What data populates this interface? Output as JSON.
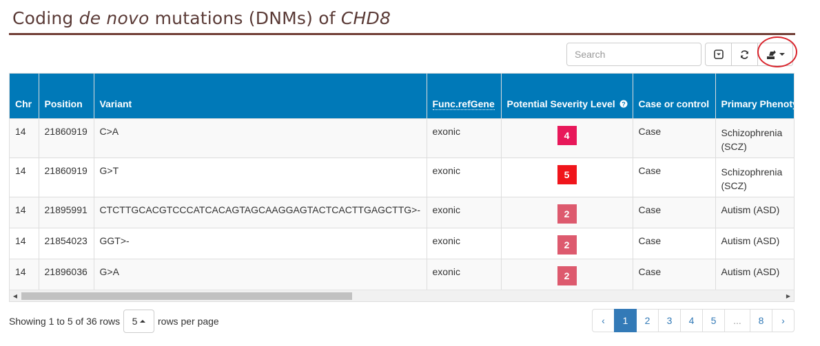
{
  "title": {
    "prefix": "Coding ",
    "italic1": "de novo",
    "middle": " mutations (DNMs) of ",
    "italic2": "CHD8"
  },
  "search": {
    "placeholder": "Search"
  },
  "toolbar": {
    "toggle_icon": "toggle-view-icon",
    "refresh_icon": "refresh-icon",
    "export_icon": "export-icon"
  },
  "table": {
    "columns": [
      "Chr",
      "Position",
      "Variant",
      "Func.refGene",
      "Potential Severity Level",
      "Case or control",
      "Primary Phenotype"
    ],
    "rows": [
      {
        "chr": "14",
        "position": "21860919",
        "variant": "C>A",
        "func": "exonic",
        "severity": "4",
        "severity_color": "#e8185a",
        "case": "Case",
        "phenotype": "Schizophrenia (SCZ)"
      },
      {
        "chr": "14",
        "position": "21860919",
        "variant": "G>T",
        "func": "exonic",
        "severity": "5",
        "severity_color": "#f0151b",
        "case": "Case",
        "phenotype": "Schizophrenia (SCZ)"
      },
      {
        "chr": "14",
        "position": "21895991",
        "variant": "CTCTTGCACGTCCCATCACAGTAGCAAGGAGTACTCACTTGAGCTTG>-",
        "func": "exonic",
        "severity": "2",
        "severity_color": "#dd5a6e",
        "case": "Case",
        "phenotype": "Autism (ASD)"
      },
      {
        "chr": "14",
        "position": "21854023",
        "variant": "GGT>-",
        "func": "exonic",
        "severity": "2",
        "severity_color": "#dd5a6e",
        "case": "Case",
        "phenotype": "Autism (ASD)"
      },
      {
        "chr": "14",
        "position": "21896036",
        "variant": "G>A",
        "func": "exonic",
        "severity": "2",
        "severity_color": "#dd5a6e",
        "case": "Case",
        "phenotype": "Autism (ASD)"
      }
    ]
  },
  "footer": {
    "showing": "Showing 1 to 5 of 36 rows",
    "page_size": "5",
    "rows_per_page": "rows per page"
  },
  "pagination": {
    "prev": "‹",
    "pages": [
      "1",
      "2",
      "3",
      "4",
      "5",
      "...",
      "8"
    ],
    "next": "›",
    "active": "1"
  }
}
